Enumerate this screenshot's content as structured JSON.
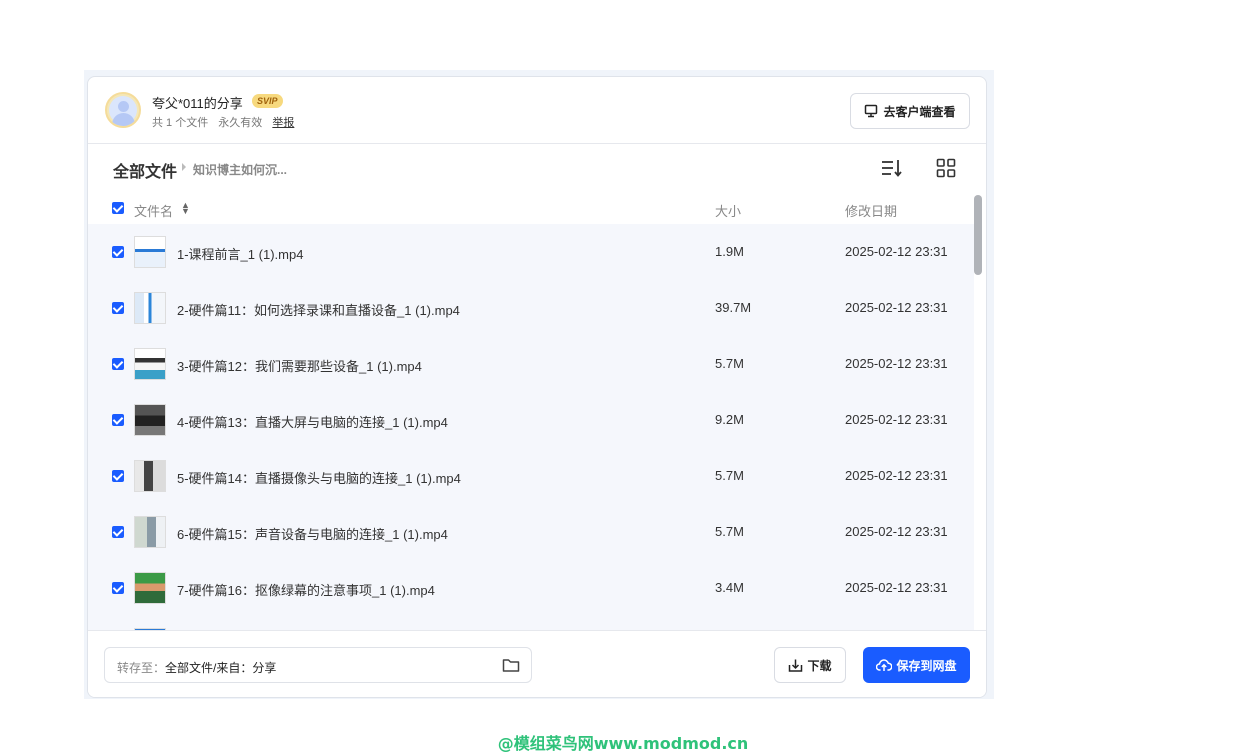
{
  "header": {
    "title": "夸父*011的分享",
    "badge": "SVIP",
    "file_count": "共 1 个文件",
    "validity": "永久有效",
    "report": "举报",
    "client_button": "去客户端查看"
  },
  "breadcrumb": {
    "root": "全部文件",
    "current": "知识博主如何沉..."
  },
  "columns": {
    "name": "文件名",
    "size": "大小",
    "date": "修改日期"
  },
  "files": [
    {
      "name": "1-课程前言_1 (1).mp4",
      "size": "1.9M",
      "date": "2025-02-12 23:31"
    },
    {
      "name": "2-硬件篇11：如何选择录课和直播设备_1 (1).mp4",
      "size": "39.7M",
      "date": "2025-02-12 23:31"
    },
    {
      "name": "3-硬件篇12：我们需要那些设备_1 (1).mp4",
      "size": "5.7M",
      "date": "2025-02-12 23:31"
    },
    {
      "name": "4-硬件篇13：直播大屏与电脑的连接_1 (1).mp4",
      "size": "9.2M",
      "date": "2025-02-12 23:31"
    },
    {
      "name": "5-硬件篇14：直播摄像头与电脑的连接_1 (1).mp4",
      "size": "5.7M",
      "date": "2025-02-12 23:31"
    },
    {
      "name": "6-硬件篇15：声音设备与电脑的连接_1 (1).mp4",
      "size": "5.7M",
      "date": "2025-02-12 23:31"
    },
    {
      "name": "7-硬件篇16：抠像绿幕的注意事项_1 (1).mp4",
      "size": "3.4M",
      "date": "2025-02-12 23:31"
    }
  ],
  "footer": {
    "save_label": "转存至：",
    "save_path": "全部文件/来自：分享",
    "download": "下载",
    "save_button": "保存到网盘"
  },
  "watermark": "@模组菜鸟网www.modmod.cn",
  "colors": {
    "accent": "#1a5cff",
    "watermark": "#2fc27a",
    "svip": "#f7d97e"
  }
}
